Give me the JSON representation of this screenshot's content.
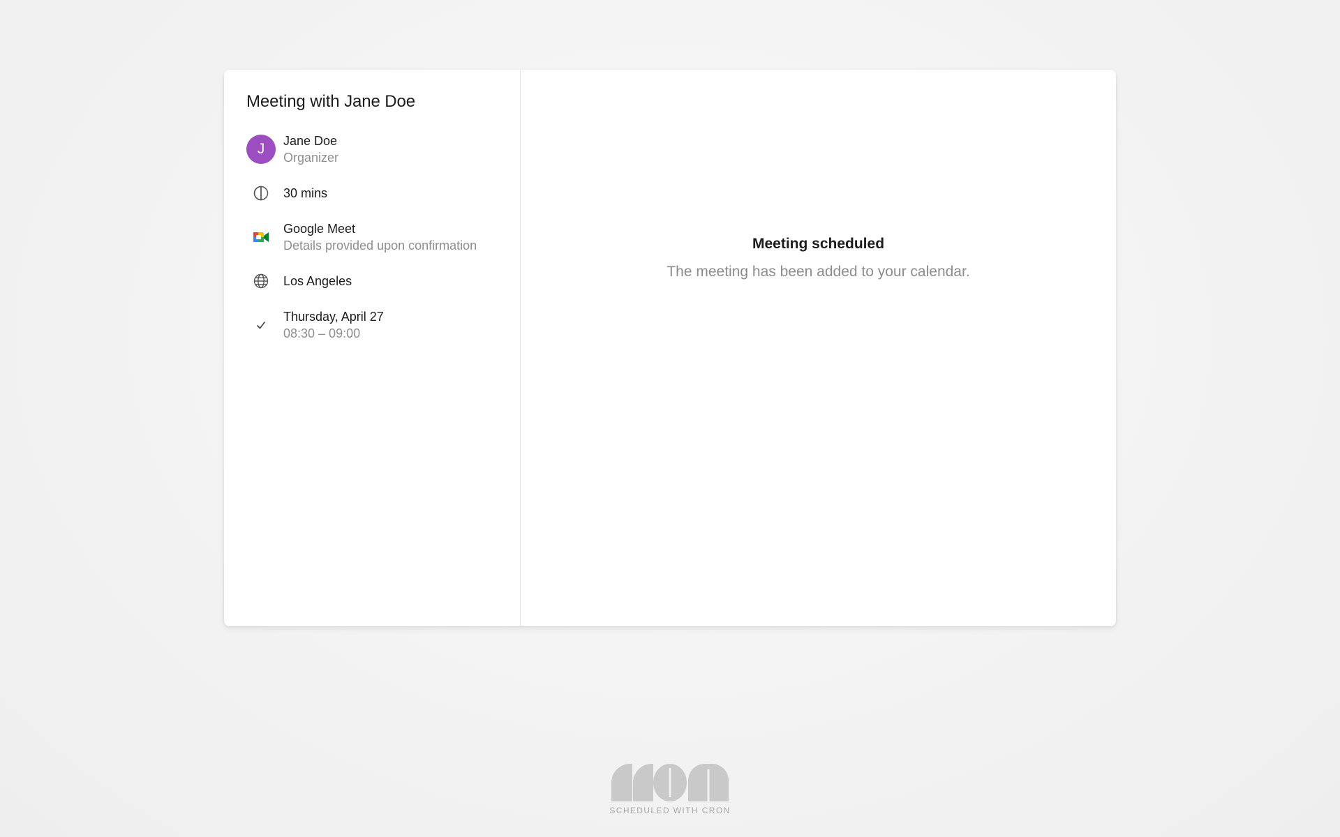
{
  "meeting": {
    "title": "Meeting with Jane Doe",
    "organizer": {
      "initial": "J",
      "name": "Jane Doe",
      "role": "Organizer",
      "avatar_color": "#9c4dbf"
    },
    "duration": {
      "icon": "half-circle-icon",
      "label": "30 mins"
    },
    "conferencing": {
      "icon": "google-meet-icon",
      "name": "Google Meet",
      "details": "Details provided upon confirmation"
    },
    "timezone": {
      "icon": "globe-icon",
      "label": "Los Angeles"
    },
    "date": {
      "icon": "check-icon",
      "day": "Thursday, April 27",
      "time": "08:30 – 09:00"
    }
  },
  "confirmation": {
    "heading": "Meeting scheduled",
    "message": "The meeting has been added to your calendar."
  },
  "footer": {
    "logo": "cron-logo",
    "caption": "SCHEDULED WITH CRON"
  },
  "colors": {
    "background": "#f2f2f2",
    "card": "#ffffff",
    "muted_text": "#8e8e8e"
  }
}
